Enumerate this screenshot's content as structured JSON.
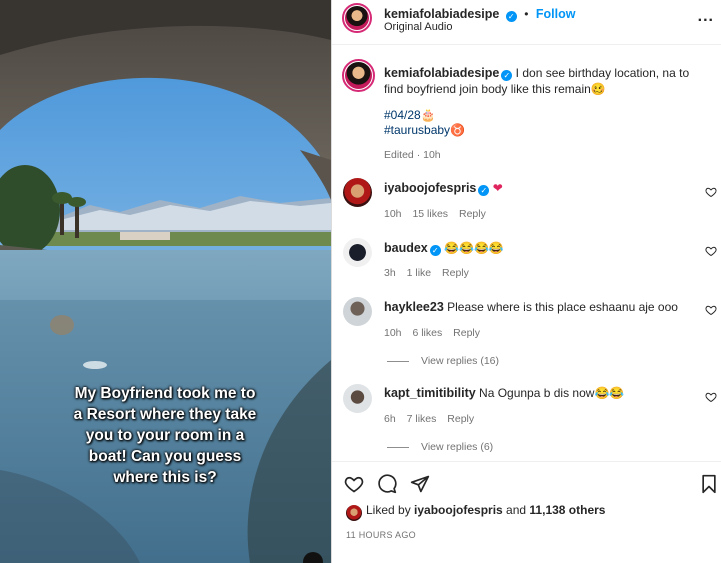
{
  "media": {
    "caption_lines": [
      "My Boyfriend took me to",
      "a Resort where they take",
      "you to your room in a",
      "boat! Can you guess",
      "where this is?"
    ]
  },
  "header": {
    "username": "kemiafolabiadesipe",
    "verified_icon": "verified-badge",
    "separator": "•",
    "follow_label": "Follow",
    "audio": "Original Audio",
    "more_label": "..."
  },
  "post": {
    "username": "kemiafolabiadesipe",
    "text": "I don see birthday location, na to find boyfriend join body like this remain🥴",
    "hashtag1": "#04/28🎂",
    "hashtag2": "#taurusbaby♉",
    "edited": "Edited · 10h"
  },
  "comments": [
    {
      "username": "iyaboojofespris",
      "text": "❤",
      "time": "10h",
      "likes": "15 likes",
      "reply": "Reply",
      "verified": true
    },
    {
      "username": "baudex",
      "text": "😂😂😂😂",
      "time": "3h",
      "likes": "1 like",
      "reply": "Reply",
      "verified": true
    },
    {
      "username": "hayklee23",
      "text": "Please where is this place eshaanu aje ooo",
      "time": "10h",
      "likes": "6 likes",
      "reply": "Reply",
      "view_replies": "View replies (16)"
    },
    {
      "username": "kapt_timitibility",
      "text": "Na Ogunpa b dis now😂😂",
      "time": "6h",
      "likes": "7 likes",
      "reply": "Reply",
      "view_replies": "View replies (6)"
    }
  ],
  "footer": {
    "liked_by_prefix": "Liked by ",
    "liked_by_user": "iyaboojofespris",
    "liked_by_suffix": " and ",
    "others": "11,138 others",
    "timestamp": "11 HOURS AGO"
  },
  "colors": {
    "link_blue": "#0095f6",
    "hashtag_blue": "#00376b",
    "heart_red": "#e0245e"
  }
}
